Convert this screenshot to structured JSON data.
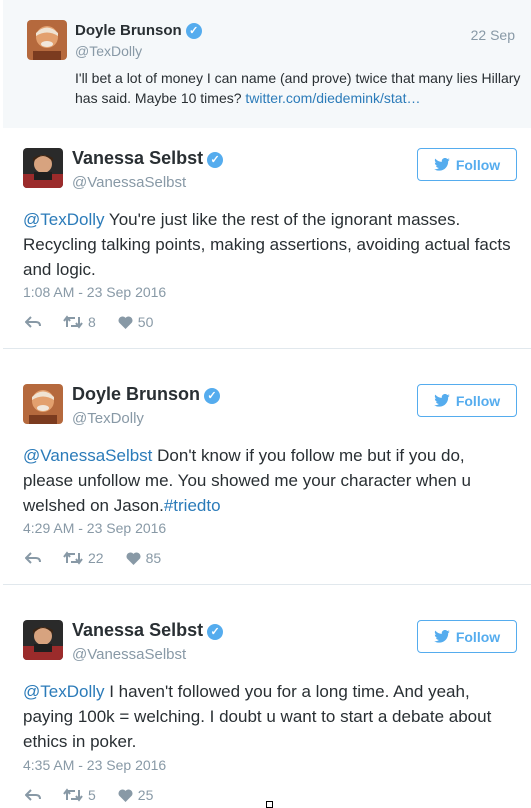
{
  "parent_tweet": {
    "name": "Doyle Brunson",
    "handle": "@TexDolly",
    "date": "22 Sep",
    "text": "I'll bet a lot of money I can name (and prove) twice that many lies Hillary has said. Maybe 10 times?",
    "link": "twitter.com/diedemink/stat…",
    "avatar_icon": "avatar-photo-icon"
  },
  "tweets": [
    {
      "name": "Vanessa Selbst",
      "handle": "@VanessaSelbst",
      "follow_label": "Follow",
      "mention": "@TexDolly",
      "text": " You're just like the rest of the ignorant masses. Recycling talking points, making assertions, avoiding actual facts and logic.",
      "hashtag": "",
      "timestamp": "1:08 AM - 23 Sep 2016",
      "retweets": "8",
      "likes": "50"
    },
    {
      "name": "Doyle Brunson",
      "handle": "@TexDolly",
      "follow_label": "Follow",
      "mention": "@VanessaSelbst",
      "text": " Don't know if you follow me but if you do, please unfollow me. You showed me your character when u welshed on Jason.",
      "hashtag": "#triedto",
      "timestamp": "4:29 AM - 23 Sep 2016",
      "retweets": "22",
      "likes": "85"
    },
    {
      "name": "Vanessa Selbst",
      "handle": "@VanessaSelbst",
      "follow_label": "Follow",
      "mention": "@TexDolly",
      "text": " I haven't followed you for a long time. And yeah, paying 100k = welching. I doubt u want to start a debate about ethics in poker.",
      "hashtag": "",
      "timestamp": "4:35 AM - 23 Sep 2016",
      "retweets": "5",
      "likes": "25"
    }
  ],
  "icons": {
    "verified": "verified-badge-icon",
    "bird": "twitter-bird-icon",
    "reply": "reply-icon",
    "retweet": "retweet-icon",
    "like": "heart-icon"
  },
  "colors": {
    "accent": "#55acee",
    "link": "#2b7bb9",
    "muted": "#8899a6",
    "text": "#292f33",
    "parent_bg": "#f5f8fa"
  }
}
